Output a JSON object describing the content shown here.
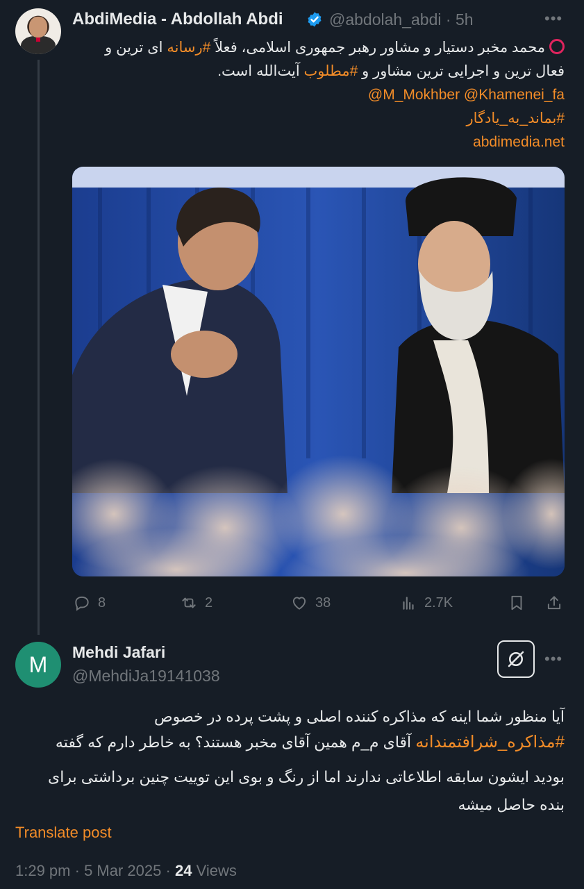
{
  "tweet": {
    "display_name": "AbdiMedia - Abdollah Abdi",
    "handle": "@abdolah_abdi",
    "separator": "·",
    "time": "5h",
    "text": {
      "l1_a": "محمد مخبر دستیار و مشاور رهبر جمهوری اسلامی، فعلاً ",
      "l1_tag": "#رسانه",
      "l1_b": " ای ترین و",
      "l2_a": "فعال ترین و اجرایی ترین مشاور و ",
      "l2_tag": "#مطلوب",
      "l2_b": " آیت‌الله است.",
      "mentions": "@M_Mokhber @Khamenei_fa",
      "hashtag": "#بماند_به_یادگار",
      "link": "abdimedia.net"
    },
    "actions": {
      "replies": "8",
      "retweets": "2",
      "likes": "38",
      "views": "2.7K"
    }
  },
  "reply": {
    "avatar_letter": "M",
    "display_name": "Mehdi Jafari",
    "handle": "@MehdiJa19141038",
    "text": {
      "l1": "آیا منظور شما اینه که مذاکره کننده اصلی و پشت پرده در خصوص",
      "l2_tag": "#مذاکره_شرافتمندانه",
      "l2_b": " آقای م_م همین آقای مخبر هستند؟ به خاطر دارم که گفته",
      "l3": "بودید ایشون سابقه اطلاعاتی ندارند اما از رنگ و بوی این توییت چنین برداشتی برای",
      "l4": "بنده حاصل میشه"
    },
    "translate_label": "Translate post",
    "time": "1:29 pm",
    "date": "5 Mar 2025",
    "views_count": "24",
    "views_label": "Views"
  },
  "colors": {
    "background": "#161d26",
    "accent": "#f28c28",
    "muted": "#71767b",
    "verified": "#1d9bf0"
  }
}
